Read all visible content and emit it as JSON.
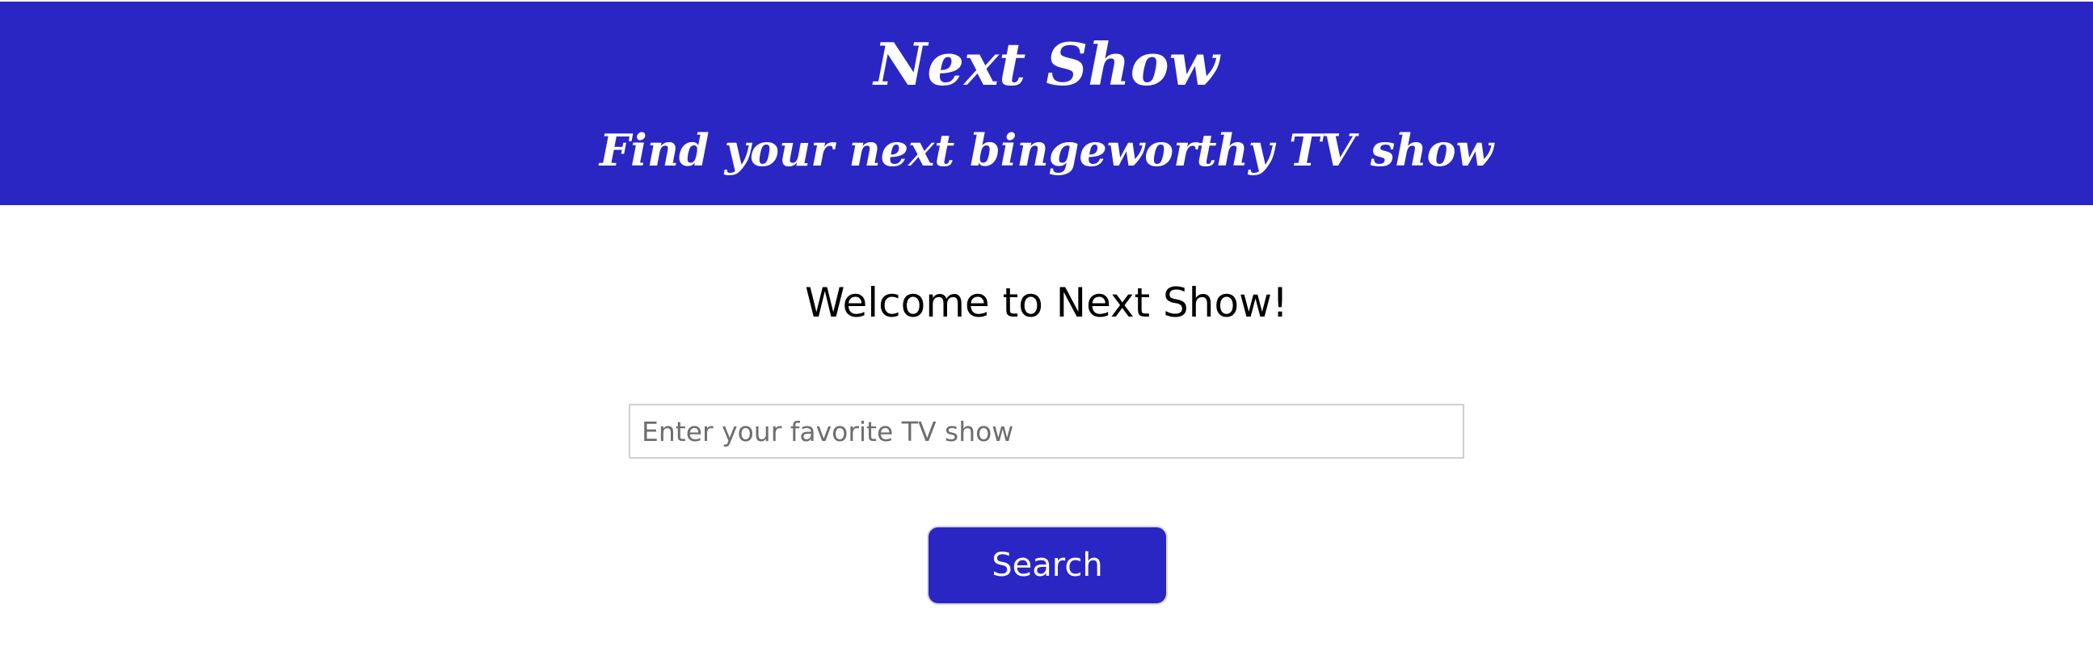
{
  "header": {
    "title": "Next Show",
    "subtitle": "Find your next bingeworthy TV show"
  },
  "main": {
    "welcome": "Welcome to Next Show!",
    "search": {
      "value": "",
      "placeholder": "Enter your favorite TV show",
      "button_label": "Search"
    }
  },
  "colors": {
    "brand": "#2a26c4",
    "header_text": "#ffffff",
    "body_text": "#000000",
    "input_border": "#cfcfcf"
  }
}
